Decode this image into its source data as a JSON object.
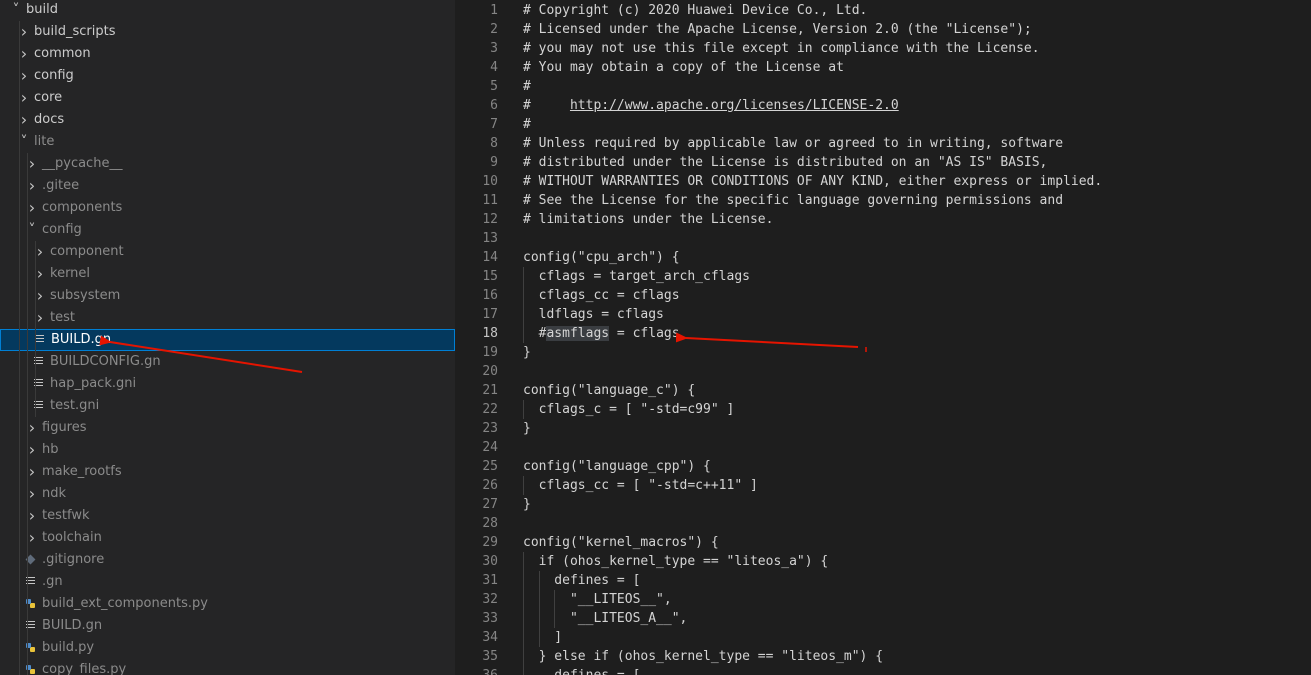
{
  "explorer": {
    "items": [
      {
        "label": "build",
        "kind": "folder",
        "open": true,
        "depth": 0
      },
      {
        "label": "build_scripts",
        "kind": "folder",
        "open": false,
        "depth": 1
      },
      {
        "label": "common",
        "kind": "folder",
        "open": false,
        "depth": 1
      },
      {
        "label": "config",
        "kind": "folder",
        "open": false,
        "depth": 1
      },
      {
        "label": "core",
        "kind": "folder",
        "open": false,
        "depth": 1
      },
      {
        "label": "docs",
        "kind": "folder",
        "open": false,
        "depth": 1
      },
      {
        "label": "lite",
        "kind": "folder",
        "open": true,
        "depth": 1,
        "dim": true
      },
      {
        "label": "__pycache__",
        "kind": "folder",
        "open": false,
        "depth": 2,
        "dim": true
      },
      {
        "label": ".gitee",
        "kind": "folder",
        "open": false,
        "depth": 2,
        "dim": true
      },
      {
        "label": "components",
        "kind": "folder",
        "open": false,
        "depth": 2,
        "dim": true
      },
      {
        "label": "config",
        "kind": "folder",
        "open": true,
        "depth": 2,
        "dim": true
      },
      {
        "label": "component",
        "kind": "folder",
        "open": false,
        "depth": 3,
        "dim": true
      },
      {
        "label": "kernel",
        "kind": "folder",
        "open": false,
        "depth": 3,
        "dim": true
      },
      {
        "label": "subsystem",
        "kind": "folder",
        "open": false,
        "depth": 3,
        "dim": true
      },
      {
        "label": "test",
        "kind": "folder",
        "open": false,
        "depth": 3,
        "dim": true
      },
      {
        "label": "BUILD.gn",
        "kind": "file-lines",
        "depth": 3,
        "selected": true
      },
      {
        "label": "BUILDCONFIG.gn",
        "kind": "file-lines",
        "depth": 3,
        "dim": true
      },
      {
        "label": "hap_pack.gni",
        "kind": "file-lines",
        "depth": 3,
        "dim": true
      },
      {
        "label": "test.gni",
        "kind": "file-lines",
        "depth": 3,
        "dim": true
      },
      {
        "label": "figures",
        "kind": "folder",
        "open": false,
        "depth": 2,
        "dim": true
      },
      {
        "label": "hb",
        "kind": "folder",
        "open": false,
        "depth": 2,
        "dim": true
      },
      {
        "label": "make_rootfs",
        "kind": "folder",
        "open": false,
        "depth": 2,
        "dim": true
      },
      {
        "label": "ndk",
        "kind": "folder",
        "open": false,
        "depth": 2,
        "dim": true
      },
      {
        "label": "testfwk",
        "kind": "folder",
        "open": false,
        "depth": 2,
        "dim": true
      },
      {
        "label": "toolchain",
        "kind": "folder",
        "open": false,
        "depth": 2,
        "dim": true
      },
      {
        "label": ".gitignore",
        "kind": "file-git",
        "depth": 2,
        "dim": true
      },
      {
        "label": ".gn",
        "kind": "file-lines",
        "depth": 2,
        "dim": true
      },
      {
        "label": "build_ext_components.py",
        "kind": "file-py",
        "depth": 2,
        "dim": true
      },
      {
        "label": "BUILD.gn",
        "kind": "file-lines",
        "depth": 2,
        "dim": true
      },
      {
        "label": "build.py",
        "kind": "file-py",
        "depth": 2,
        "dim": true
      },
      {
        "label": "copy_files.py",
        "kind": "file-py",
        "depth": 2,
        "dim": true
      }
    ]
  },
  "editor": {
    "active_line": 18,
    "lines": [
      {
        "n": "1",
        "text": "# Copyright (c) 2020 Huawei Device Co., Ltd."
      },
      {
        "n": "2",
        "text": "# Licensed under the Apache License, Version 2.0 (the \"License\");"
      },
      {
        "n": "3",
        "text": "# you may not use this file except in compliance with the License."
      },
      {
        "n": "4",
        "text": "# You may obtain a copy of the License at"
      },
      {
        "n": "5",
        "text": "#"
      },
      {
        "n": "6",
        "text": "#     ",
        "url": "http://www.apache.org/licenses/LICENSE-2.0"
      },
      {
        "n": "7",
        "text": "#"
      },
      {
        "n": "8",
        "text": "# Unless required by applicable law or agreed to in writing, software"
      },
      {
        "n": "9",
        "text": "# distributed under the License is distributed on an \"AS IS\" BASIS,"
      },
      {
        "n": "10",
        "text": "# WITHOUT WARRANTIES OR CONDITIONS OF ANY KIND, either express or implied."
      },
      {
        "n": "11",
        "text": "# See the License for the specific language governing permissions and"
      },
      {
        "n": "12",
        "text": "# limitations under the License."
      },
      {
        "n": "13",
        "text": ""
      },
      {
        "n": "14",
        "text": "config(\"cpu_arch\") {"
      },
      {
        "n": "15",
        "text": "  cflags = target_arch_cflags"
      },
      {
        "n": "16",
        "text": "  cflags_cc = cflags"
      },
      {
        "n": "17",
        "text": "  ldflags = cflags"
      },
      {
        "n": "18",
        "text": "  #",
        "highlight": "asmflags",
        "after": " = cflags"
      },
      {
        "n": "19",
        "text": "}"
      },
      {
        "n": "20",
        "text": ""
      },
      {
        "n": "21",
        "text": "config(\"language_c\") {"
      },
      {
        "n": "22",
        "text": "  cflags_c = [ \"-std=c99\" ]"
      },
      {
        "n": "23",
        "text": "}"
      },
      {
        "n": "24",
        "text": ""
      },
      {
        "n": "25",
        "text": "config(\"language_cpp\") {"
      },
      {
        "n": "26",
        "text": "  cflags_cc = [ \"-std=c++11\" ]"
      },
      {
        "n": "27",
        "text": "}"
      },
      {
        "n": "28",
        "text": ""
      },
      {
        "n": "29",
        "text": "config(\"kernel_macros\") {"
      },
      {
        "n": "30",
        "text": "  if (ohos_kernel_type == \"liteos_a\") {"
      },
      {
        "n": "31",
        "text": "    defines = ["
      },
      {
        "n": "32",
        "text": "      \"__LITEOS__\","
      },
      {
        "n": "33",
        "text": "      \"__LITEOS_A__\","
      },
      {
        "n": "34",
        "text": "    ]"
      },
      {
        "n": "35",
        "text": "  } else if (ohos_kernel_type == \"liteos_m\") {"
      },
      {
        "n": "36",
        "text": "    defines = ["
      }
    ]
  },
  "colors": {
    "sidebar_bg": "#252526",
    "editor_bg": "#1e1e1e",
    "selection_bg": "#04395e",
    "selection_border": "#007fd4",
    "annotation_arrow": "#e51400"
  }
}
